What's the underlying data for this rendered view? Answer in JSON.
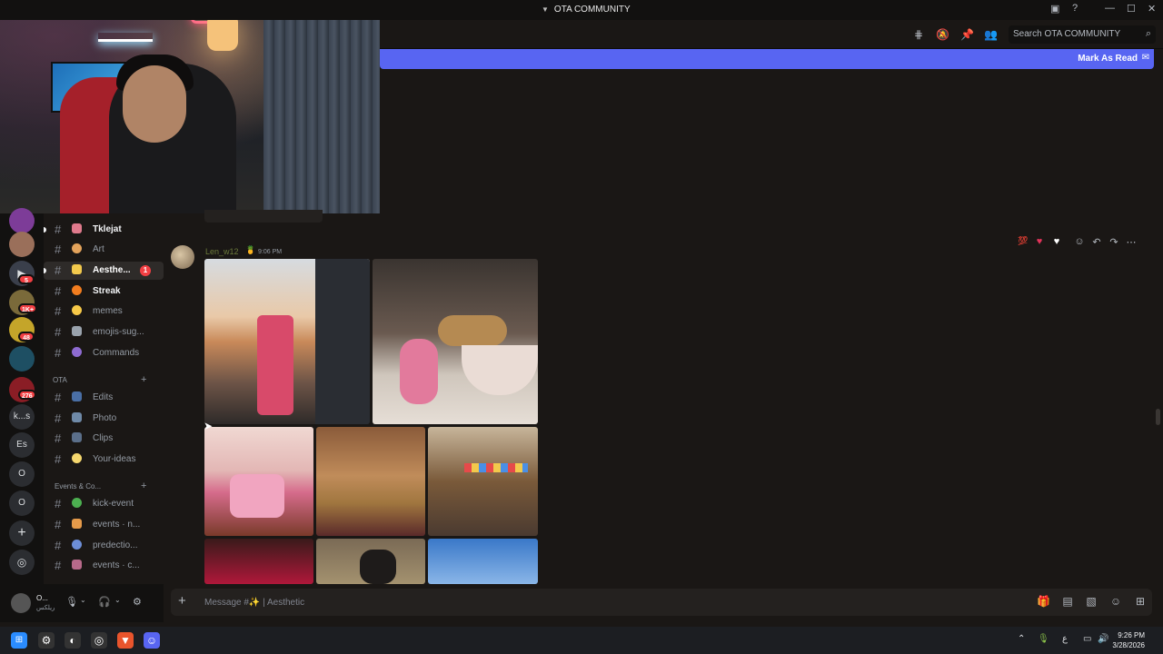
{
  "window": {
    "title": "OTA COMMUNITY"
  },
  "header": {
    "search_placeholder": "Search OTA COMMUNITY"
  },
  "new_messages_bar": {
    "label": "Mark As Read"
  },
  "servers": [
    {
      "label": "",
      "badge": "5"
    },
    {
      "label": "",
      "badge": "1K+"
    },
    {
      "label": "",
      "badge": "48"
    },
    {
      "label": "",
      "badge": "276"
    },
    {
      "label": "k...s",
      "badge": ""
    },
    {
      "label": "Es",
      "badge": ""
    },
    {
      "label": "O",
      "badge": ""
    },
    {
      "label": "O",
      "badge": ""
    }
  ],
  "channels": {
    "top": [
      {
        "name": "Tklejat",
        "style": "bold"
      },
      {
        "name": "Art",
        "style": "normal"
      },
      {
        "name": "Aesthe...",
        "style": "active",
        "badge": "1"
      },
      {
        "name": "Streak",
        "style": "bold"
      },
      {
        "name": "memes",
        "style": "normal"
      },
      {
        "name": "emojis-sug...",
        "style": "normal"
      },
      {
        "name": "Commands",
        "style": "normal"
      }
    ],
    "category_ota": "OTA",
    "ota": [
      {
        "name": "Edits"
      },
      {
        "name": "Photo"
      },
      {
        "name": "Clips"
      },
      {
        "name": "Your-ideas"
      }
    ],
    "category_events": "Events & Co...",
    "events": [
      {
        "name": "kick-event"
      },
      {
        "name": "events · n..."
      },
      {
        "name": "predectio..."
      },
      {
        "name": "events · c..."
      }
    ]
  },
  "message": {
    "author": "Len_w12",
    "author_emoji": "🍍",
    "time": "9:06 PM"
  },
  "composer": {
    "placeholder": "Message #✨ | Aesthetic"
  },
  "user_panel": {
    "name": "O...",
    "status": "ريلكس"
  },
  "taskbar": {
    "time": "9:26 PM",
    "date": "3/28/2026",
    "lang": "ع"
  },
  "colors": {
    "accent": "#5865f2",
    "badge": "#f23f43"
  }
}
